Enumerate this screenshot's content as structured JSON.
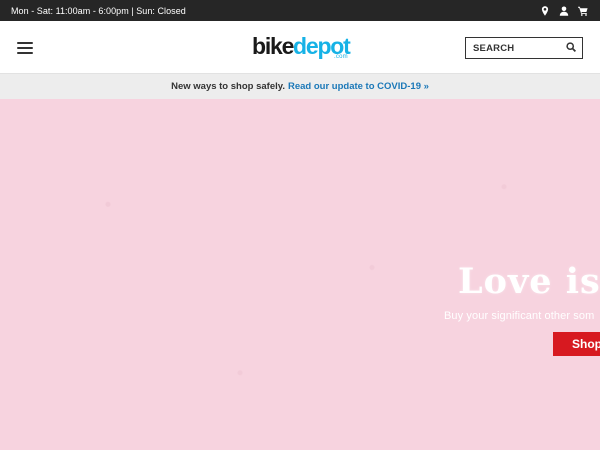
{
  "topbar": {
    "hours": "Mon - Sat: 11:00am - 6:00pm | Sun: Closed",
    "icons": [
      "location-icon",
      "account-icon",
      "cart-icon"
    ]
  },
  "header": {
    "logo": {
      "part1": "bike",
      "part2": "depot",
      "part3": ".com"
    },
    "search_placeholder": "SEARCH"
  },
  "notice": {
    "text": "New ways to shop safely.",
    "link": "Read our update to COVID-19 »"
  },
  "hero": {
    "headline": "Love is i",
    "subtext": "Buy your significant other som",
    "button": "Shop"
  },
  "colors": {
    "topbar_bg": "#262626",
    "brand_blue": "#16b2e6",
    "link_blue": "#1b78b8",
    "hero_bg": "#f7d3df",
    "cta_red": "#d71920"
  }
}
